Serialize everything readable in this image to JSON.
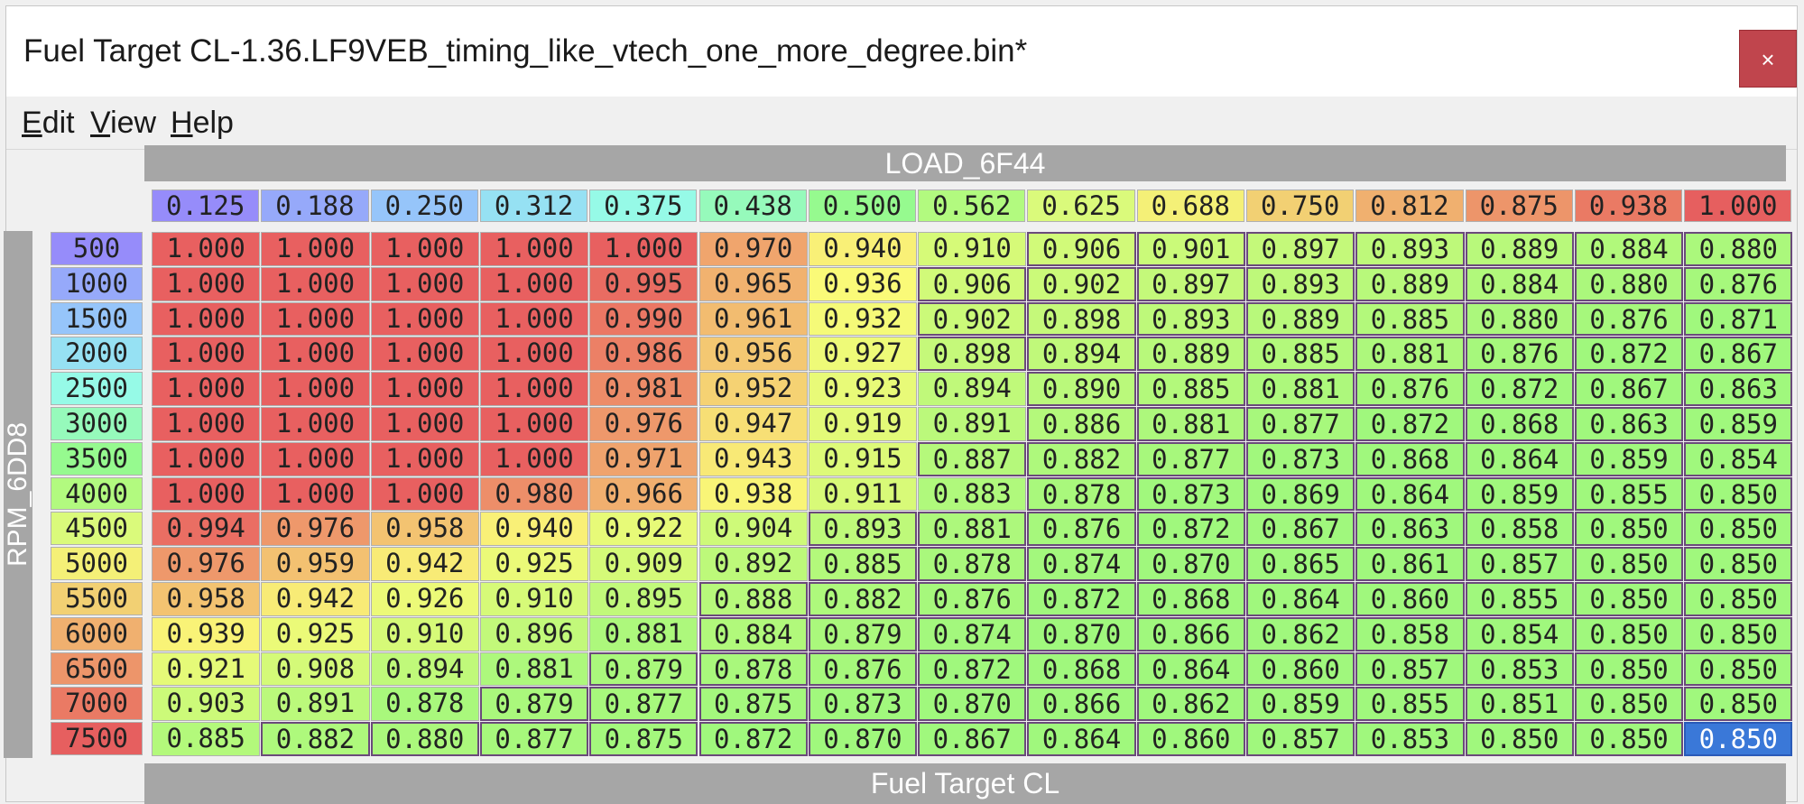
{
  "window": {
    "title": "Fuel Target CL-1.36.LF9VEB_timing_like_vtech_one_more_degree.bin*",
    "close_symbol": "×"
  },
  "menu": [
    {
      "key": "E",
      "rest": "dit"
    },
    {
      "key": "V",
      "rest": "iew"
    },
    {
      "key": "H",
      "rest": "elp"
    }
  ],
  "x_axis_label": "LOAD_6F44",
  "y_axis_label": "RPM_6DD8",
  "table_name": "Fuel Target CL",
  "selected_cell": [
    14,
    14
  ],
  "columns": [
    "0.125",
    "0.188",
    "0.250",
    "0.312",
    "0.375",
    "0.438",
    "0.500",
    "0.562",
    "0.625",
    "0.688",
    "0.750",
    "0.812",
    "0.875",
    "0.938",
    "1.000"
  ],
  "rows": [
    "500",
    "1000",
    "1500",
    "2000",
    "2500",
    "3000",
    "3500",
    "4000",
    "4500",
    "5000",
    "5500",
    "6000",
    "6500",
    "7000",
    "7500"
  ],
  "values": [
    [
      "1.000",
      "1.000",
      "1.000",
      "1.000",
      "1.000",
      "0.970",
      "0.940",
      "0.910",
      "0.906",
      "0.901",
      "0.897",
      "0.893",
      "0.889",
      "0.884",
      "0.880"
    ],
    [
      "1.000",
      "1.000",
      "1.000",
      "1.000",
      "0.995",
      "0.965",
      "0.936",
      "0.906",
      "0.902",
      "0.897",
      "0.893",
      "0.889",
      "0.884",
      "0.880",
      "0.876"
    ],
    [
      "1.000",
      "1.000",
      "1.000",
      "1.000",
      "0.990",
      "0.961",
      "0.932",
      "0.902",
      "0.898",
      "0.893",
      "0.889",
      "0.885",
      "0.880",
      "0.876",
      "0.871"
    ],
    [
      "1.000",
      "1.000",
      "1.000",
      "1.000",
      "0.986",
      "0.956",
      "0.927",
      "0.898",
      "0.894",
      "0.889",
      "0.885",
      "0.881",
      "0.876",
      "0.872",
      "0.867"
    ],
    [
      "1.000",
      "1.000",
      "1.000",
      "1.000",
      "0.981",
      "0.952",
      "0.923",
      "0.894",
      "0.890",
      "0.885",
      "0.881",
      "0.876",
      "0.872",
      "0.867",
      "0.863"
    ],
    [
      "1.000",
      "1.000",
      "1.000",
      "1.000",
      "0.976",
      "0.947",
      "0.919",
      "0.891",
      "0.886",
      "0.881",
      "0.877",
      "0.872",
      "0.868",
      "0.863",
      "0.859"
    ],
    [
      "1.000",
      "1.000",
      "1.000",
      "1.000",
      "0.971",
      "0.943",
      "0.915",
      "0.887",
      "0.882",
      "0.877",
      "0.873",
      "0.868",
      "0.864",
      "0.859",
      "0.854"
    ],
    [
      "1.000",
      "1.000",
      "1.000",
      "0.980",
      "0.966",
      "0.938",
      "0.911",
      "0.883",
      "0.878",
      "0.873",
      "0.869",
      "0.864",
      "0.859",
      "0.855",
      "0.850"
    ],
    [
      "0.994",
      "0.976",
      "0.958",
      "0.940",
      "0.922",
      "0.904",
      "0.893",
      "0.881",
      "0.876",
      "0.872",
      "0.867",
      "0.863",
      "0.858",
      "0.850",
      "0.850"
    ],
    [
      "0.976",
      "0.959",
      "0.942",
      "0.925",
      "0.909",
      "0.892",
      "0.885",
      "0.878",
      "0.874",
      "0.870",
      "0.865",
      "0.861",
      "0.857",
      "0.850",
      "0.850"
    ],
    [
      "0.958",
      "0.942",
      "0.926",
      "0.910",
      "0.895",
      "0.888",
      "0.882",
      "0.876",
      "0.872",
      "0.868",
      "0.864",
      "0.860",
      "0.855",
      "0.850",
      "0.850"
    ],
    [
      "0.939",
      "0.925",
      "0.910",
      "0.896",
      "0.881",
      "0.884",
      "0.879",
      "0.874",
      "0.870",
      "0.866",
      "0.862",
      "0.858",
      "0.854",
      "0.850",
      "0.850"
    ],
    [
      "0.921",
      "0.908",
      "0.894",
      "0.881",
      "0.879",
      "0.878",
      "0.876",
      "0.872",
      "0.868",
      "0.864",
      "0.860",
      "0.857",
      "0.853",
      "0.850",
      "0.850"
    ],
    [
      "0.903",
      "0.891",
      "0.878",
      "0.879",
      "0.877",
      "0.875",
      "0.873",
      "0.870",
      "0.866",
      "0.862",
      "0.859",
      "0.855",
      "0.851",
      "0.850",
      "0.850"
    ],
    [
      "0.885",
      "0.882",
      "0.880",
      "0.877",
      "0.875",
      "0.872",
      "0.870",
      "0.867",
      "0.864",
      "0.860",
      "0.857",
      "0.853",
      "0.850",
      "0.850",
      "0.850"
    ]
  ],
  "boxed": [
    [
      0,
      0,
      0,
      0,
      0,
      0,
      0,
      0,
      1,
      1,
      1,
      1,
      1,
      1,
      1
    ],
    [
      0,
      0,
      0,
      0,
      0,
      0,
      0,
      1,
      1,
      1,
      1,
      1,
      1,
      1,
      1
    ],
    [
      0,
      0,
      0,
      0,
      0,
      0,
      0,
      1,
      1,
      1,
      1,
      1,
      1,
      1,
      1
    ],
    [
      0,
      0,
      0,
      0,
      0,
      0,
      0,
      1,
      1,
      1,
      1,
      1,
      1,
      1,
      1
    ],
    [
      0,
      0,
      0,
      0,
      0,
      0,
      0,
      0,
      1,
      1,
      1,
      1,
      1,
      1,
      1
    ],
    [
      0,
      0,
      0,
      0,
      0,
      0,
      0,
      0,
      1,
      1,
      1,
      1,
      1,
      1,
      1
    ],
    [
      0,
      0,
      0,
      0,
      0,
      0,
      0,
      1,
      1,
      1,
      1,
      1,
      1,
      1,
      1
    ],
    [
      0,
      0,
      0,
      0,
      0,
      0,
      0,
      0,
      1,
      1,
      1,
      1,
      1,
      1,
      1
    ],
    [
      0,
      0,
      0,
      0,
      0,
      0,
      1,
      1,
      1,
      1,
      1,
      1,
      1,
      1,
      1
    ],
    [
      0,
      0,
      0,
      0,
      0,
      0,
      1,
      1,
      1,
      1,
      1,
      1,
      1,
      1,
      1
    ],
    [
      0,
      0,
      0,
      0,
      0,
      1,
      1,
      1,
      1,
      1,
      1,
      1,
      1,
      1,
      1
    ],
    [
      0,
      0,
      0,
      0,
      0,
      1,
      1,
      1,
      1,
      1,
      1,
      1,
      1,
      1,
      1
    ],
    [
      0,
      0,
      0,
      0,
      1,
      1,
      1,
      1,
      1,
      1,
      1,
      1,
      1,
      1,
      1
    ],
    [
      0,
      0,
      0,
      1,
      1,
      1,
      1,
      1,
      1,
      1,
      1,
      1,
      1,
      1,
      1
    ],
    [
      0,
      1,
      1,
      1,
      1,
      1,
      1,
      1,
      1,
      1,
      1,
      1,
      1,
      1,
      1
    ]
  ]
}
